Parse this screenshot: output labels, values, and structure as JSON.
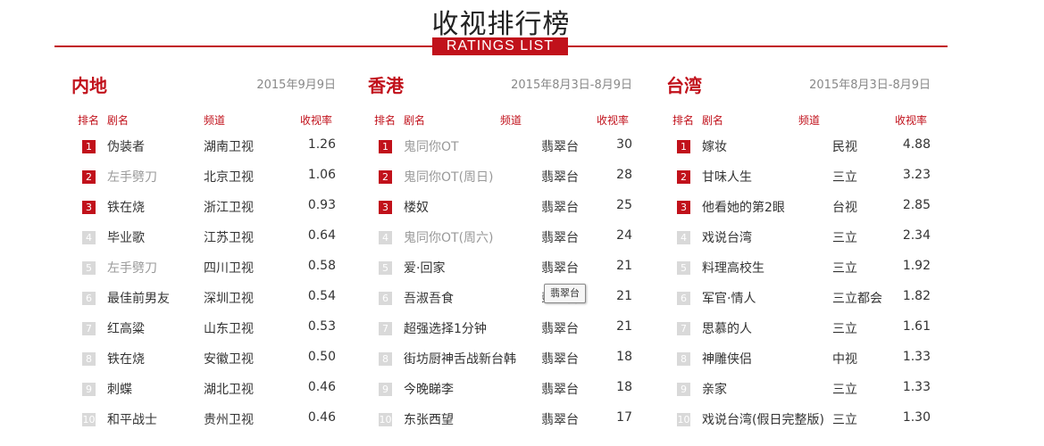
{
  "header": {
    "title": "收视排行榜",
    "subtitle": "RATINGS  LIST"
  },
  "columns_labels": {
    "rank": "排名",
    "name": "剧名",
    "channel": "频道",
    "rating": "收视率"
  },
  "tooltip": "翡翠台",
  "sections": [
    {
      "region": "内地",
      "date": "2015年9月9日",
      "rows": [
        {
          "rank": "1",
          "name": "伪装者",
          "channel": "湖南卫视",
          "rating": "1.26",
          "dim": false
        },
        {
          "rank": "2",
          "name": "左手劈刀",
          "channel": "北京卫视",
          "rating": "1.06",
          "dim": true
        },
        {
          "rank": "3",
          "name": "铁在烧",
          "channel": "浙江卫视",
          "rating": "0.93",
          "dim": false
        },
        {
          "rank": "4",
          "name": "毕业歌",
          "channel": "江苏卫视",
          "rating": "0.64",
          "dim": false
        },
        {
          "rank": "5",
          "name": "左手劈刀",
          "channel": "四川卫视",
          "rating": "0.58",
          "dim": true
        },
        {
          "rank": "6",
          "name": "最佳前男友",
          "channel": "深圳卫视",
          "rating": "0.54",
          "dim": false
        },
        {
          "rank": "7",
          "name": "红高粱",
          "channel": "山东卫视",
          "rating": "0.53",
          "dim": false
        },
        {
          "rank": "8",
          "name": "铁在烧",
          "channel": "安徽卫视",
          "rating": "0.50",
          "dim": false
        },
        {
          "rank": "9",
          "name": "刺蝶",
          "channel": "湖北卫视",
          "rating": "0.46",
          "dim": false
        },
        {
          "rank": "10",
          "name": "和平战士",
          "channel": "贵州卫视",
          "rating": "0.46",
          "dim": false
        }
      ]
    },
    {
      "region": "香港",
      "date": "2015年8月3日-8月9日",
      "rows": [
        {
          "rank": "1",
          "name": "鬼同你OT",
          "channel": "翡翠台",
          "rating": "30",
          "dim": true
        },
        {
          "rank": "2",
          "name": "鬼同你OT(周日)",
          "channel": "翡翠台",
          "rating": "28",
          "dim": true
        },
        {
          "rank": "3",
          "name": "楼奴",
          "channel": "翡翠台",
          "rating": "25",
          "dim": false
        },
        {
          "rank": "4",
          "name": "鬼同你OT(周六)",
          "channel": "翡翠台",
          "rating": "24",
          "dim": true
        },
        {
          "rank": "5",
          "name": "爱·回家",
          "channel": "翡翠台",
          "rating": "21",
          "dim": false
        },
        {
          "rank": "6",
          "name": "吾淑吾食",
          "channel": "翡翠台",
          "rating": "21",
          "dim": false
        },
        {
          "rank": "7",
          "name": "超强选择1分钟",
          "channel": "翡翠台",
          "rating": "21",
          "dim": false
        },
        {
          "rank": "8",
          "name": "街坊厨神舌战新台韩",
          "channel": "翡翠台",
          "rating": "18",
          "dim": false
        },
        {
          "rank": "9",
          "name": "今晚睇李",
          "channel": "翡翠台",
          "rating": "18",
          "dim": false
        },
        {
          "rank": "10",
          "name": "东张西望",
          "channel": "翡翠台",
          "rating": "17",
          "dim": false
        }
      ]
    },
    {
      "region": "台湾",
      "date": "2015年8月3日-8月9日",
      "rows": [
        {
          "rank": "1",
          "name": "嫁妆",
          "channel": "民视",
          "rating": "4.88",
          "dim": false
        },
        {
          "rank": "2",
          "name": "甘味人生",
          "channel": "三立",
          "rating": "3.23",
          "dim": false
        },
        {
          "rank": "3",
          "name": "他看她的第2眼",
          "channel": "台视",
          "rating": "2.85",
          "dim": false
        },
        {
          "rank": "4",
          "name": "戏说台湾",
          "channel": "三立",
          "rating": "2.34",
          "dim": false
        },
        {
          "rank": "5",
          "name": "料理高校生",
          "channel": "三立",
          "rating": "1.92",
          "dim": false
        },
        {
          "rank": "6",
          "name": "军官·情人",
          "channel": "三立都会",
          "rating": "1.82",
          "dim": false
        },
        {
          "rank": "7",
          "name": "思慕的人",
          "channel": "三立",
          "rating": "1.61",
          "dim": false
        },
        {
          "rank": "8",
          "name": "神雕侠侣",
          "channel": "中视",
          "rating": "1.33",
          "dim": false
        },
        {
          "rank": "9",
          "name": "亲家",
          "channel": "三立",
          "rating": "1.33",
          "dim": false
        },
        {
          "rank": "10",
          "name": "戏说台湾(假日完整版)",
          "channel": "三立",
          "rating": "1.30",
          "dim": false
        }
      ]
    }
  ]
}
